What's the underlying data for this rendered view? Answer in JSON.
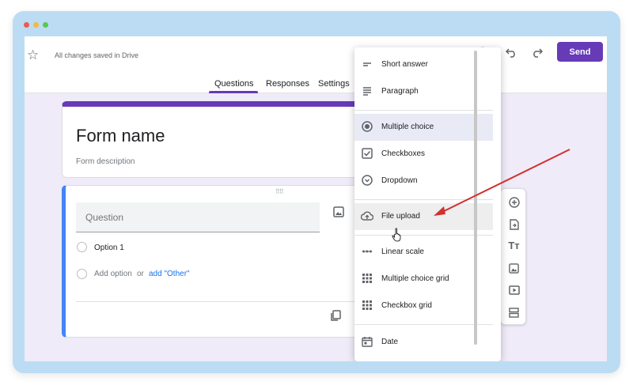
{
  "window": {
    "dots": [
      "#e95b54",
      "#f7b93e",
      "#5bc653"
    ]
  },
  "header": {
    "saved_status": "All changes saved in Drive",
    "send_label": "Send",
    "tabs": [
      {
        "label": "Questions"
      },
      {
        "label": "Responses"
      },
      {
        "label": "Settings"
      }
    ]
  },
  "form": {
    "title": "Form name",
    "description_placeholder": "Form description"
  },
  "question": {
    "placeholder": "Question",
    "option_1": "Option 1",
    "add_option": "Add option",
    "or_text": "or",
    "add_other": "add \"Other\""
  },
  "menu": {
    "items": [
      {
        "label": "Short answer",
        "icon": "short-text-icon"
      },
      {
        "label": "Paragraph",
        "icon": "paragraph-icon"
      },
      {
        "label": "Multiple choice",
        "icon": "radio-icon"
      },
      {
        "label": "Checkboxes",
        "icon": "checkbox-icon"
      },
      {
        "label": "Dropdown",
        "icon": "dropdown-icon"
      },
      {
        "label": "File upload",
        "icon": "cloud-upload-icon"
      },
      {
        "label": "Linear scale",
        "icon": "linear-scale-icon"
      },
      {
        "label": "Multiple choice grid",
        "icon": "grid-icon"
      },
      {
        "label": "Checkbox grid",
        "icon": "grid-icon"
      },
      {
        "label": "Date",
        "icon": "calendar-icon"
      }
    ],
    "selected": "Multiple choice",
    "hovered": "File upload"
  },
  "colors": {
    "accent": "#673ab7",
    "question_border": "#4285f4",
    "annotation_arrow": "#d32f2f"
  }
}
